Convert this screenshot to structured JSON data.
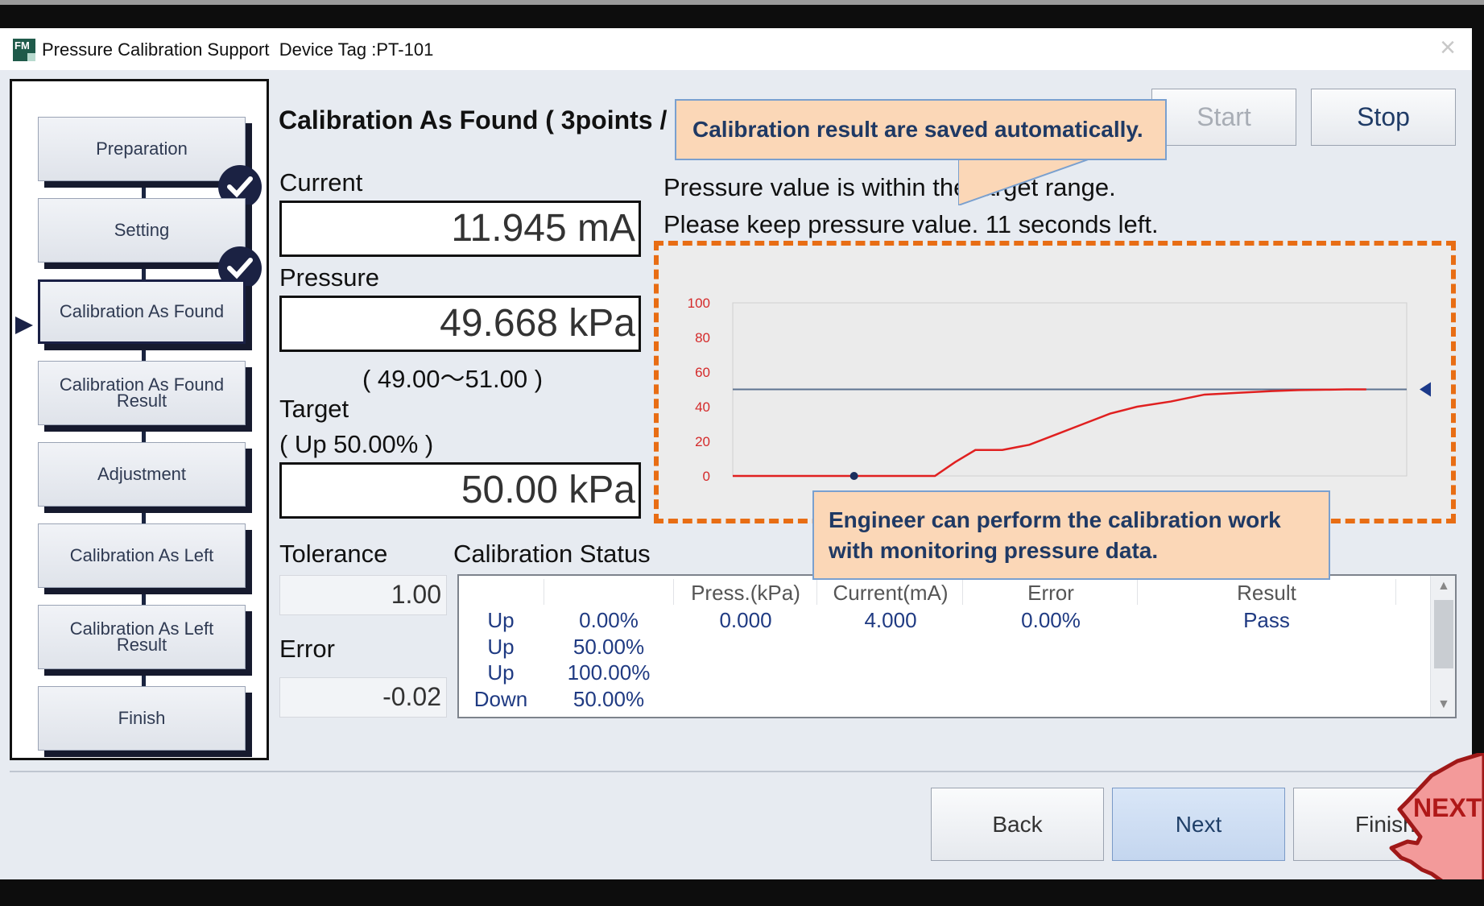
{
  "window": {
    "app_title": "Pressure Calibration Support",
    "device_tag": "Device Tag :PT-101",
    "app_icon": "FM"
  },
  "steps": [
    {
      "label": "Preparation",
      "done": true
    },
    {
      "label": "Setting",
      "done": true
    },
    {
      "label": "Calibration As Found",
      "active": true
    },
    {
      "label": "Calibration As Found Result"
    },
    {
      "label": "Adjustment"
    },
    {
      "label": "Calibration As Left"
    },
    {
      "label": "Calibration As Left Result"
    },
    {
      "label": "Finish"
    }
  ],
  "main": {
    "title": "Calibration As Found ( 3points / Up-Down )",
    "current_label": "Current",
    "current_value": "11.945 mA",
    "pressure_label": "Pressure",
    "pressure_value": "49.668 kPa",
    "pressure_range": "( 49.00～51.00 )",
    "target_label": "Target",
    "target_sub": "( Up 50.00% )",
    "target_value": "50.00 kPa",
    "tolerance_label": "Tolerance",
    "tolerance_value": "1.00",
    "error_label": "Error",
    "error_value": "-0.02",
    "message_line1": "Pressure value is within the target range.",
    "message_line2": "Please keep pressure value. 11 seconds left.",
    "status_label": "Calibration Status"
  },
  "buttons": {
    "start": "Start",
    "stop": "Stop",
    "back": "Back",
    "next": "Next",
    "finish": "Finish"
  },
  "callouts": {
    "saved": "Calibration result are saved automatically.",
    "monitor_line1": "Engineer can perform the  calibration work",
    "monitor_line2": "with monitoring pressure data."
  },
  "hand_label": "NEXT",
  "table": {
    "headers": [
      "",
      "",
      "Press.(kPa)",
      "Current(mA)",
      "Error",
      "Result"
    ],
    "rows": [
      [
        "Up",
        "0.00%",
        "0.000",
        "4.000",
        "0.00%",
        "Pass"
      ],
      [
        "Up",
        "50.00%",
        "",
        "",
        "",
        ""
      ],
      [
        "Up",
        "100.00%",
        "",
        "",
        "",
        ""
      ],
      [
        "Down",
        "50.00%",
        "",
        "",
        "",
        ""
      ]
    ]
  },
  "chart_data": {
    "type": "line",
    "y_ticks": [
      "100",
      "80",
      "60",
      "40",
      "20",
      "0"
    ],
    "ylim": [
      0,
      100
    ],
    "xlim": [
      0,
      100
    ],
    "target_line": 50,
    "series": [
      {
        "color": "#e02020",
        "x": [
          0,
          24,
          26,
          30,
          33,
          36,
          40,
          44,
          48,
          52,
          56,
          60,
          65,
          70,
          75,
          80,
          84,
          88,
          91,
          94
        ],
        "y": [
          0,
          0,
          0,
          0,
          8,
          15,
          15,
          18,
          24,
          30,
          36,
          40,
          43,
          47,
          48,
          49,
          49.6,
          49.8,
          50,
          50
        ]
      }
    ],
    "marker": {
      "x": 18,
      "y": 0
    },
    "colors": {
      "target": "#5e7390",
      "grid_bg": "#ebebeb",
      "tick": "#d42a2a",
      "marker": "#1b2f5e"
    }
  }
}
